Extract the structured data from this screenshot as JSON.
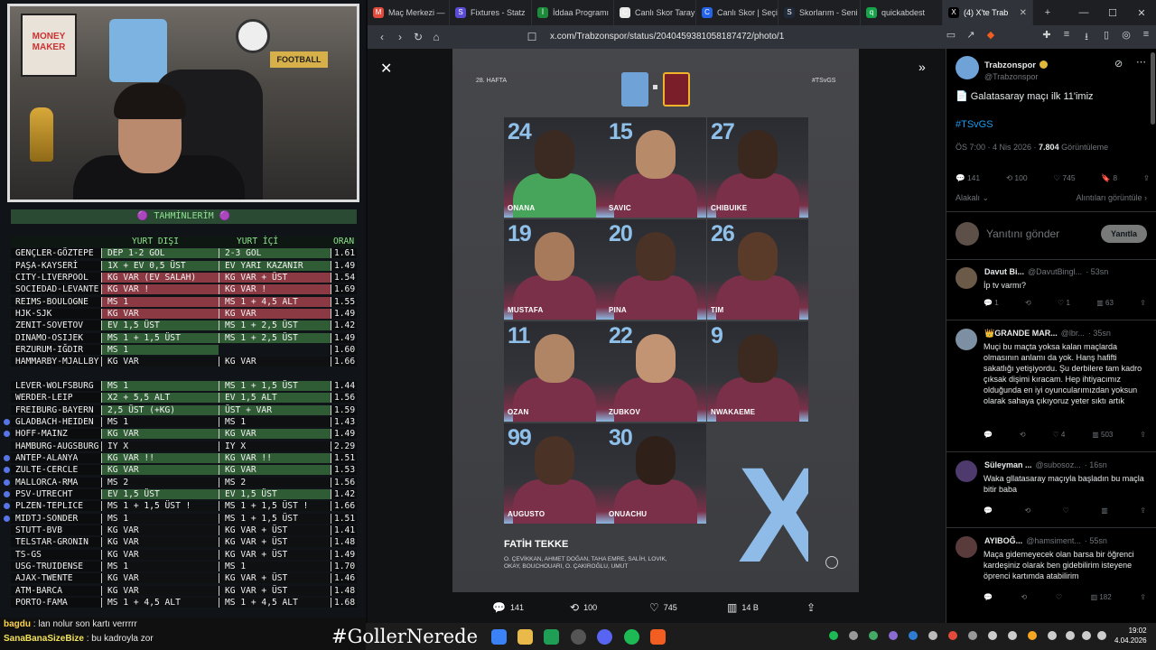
{
  "stream": {
    "predictions_title": "🟣 TAHMİNLERİM 🟣",
    "columns": {
      "away": "YURT DIŞI",
      "home": "YURT İÇİ",
      "odds": "ORAN"
    },
    "rows": [
      {
        "match": "GENÇLER-GÖZTEPE",
        "away": "DEP 1-2 GOL",
        "home": "2-3 GOL",
        "odds": "1.61",
        "ca": "c-green",
        "ch": "c-green",
        "dot": false
      },
      {
        "match": "PAŞA-KAYSERİ",
        "away": "1X + EV 0,5 ÜST",
        "home": "EV YARI KAZANIR",
        "odds": "1.49",
        "ca": "c-green",
        "ch": "c-green",
        "dot": false
      },
      {
        "match": "CITY-LIVERPOOL",
        "away": "KG VAR (EV SALAH)",
        "home": "KG VAR + ÜST",
        "odds": "1.54",
        "ca": "c-red",
        "ch": "c-red",
        "dot": false
      },
      {
        "match": "SOCIEDAD-LEVANTE",
        "away": "KG VAR !",
        "home": "KG VAR !",
        "odds": "1.69",
        "ca": "c-red",
        "ch": "c-red",
        "dot": false
      },
      {
        "match": "REIMS-BOULOGNE",
        "away": "MS 1",
        "home": "MS 1 + 4,5 ALT",
        "odds": "1.55",
        "ca": "c-red",
        "ch": "c-red",
        "dot": false
      },
      {
        "match": "HJK-SJK",
        "away": "KG VAR",
        "home": "KG VAR",
        "odds": "1.49",
        "ca": "c-red",
        "ch": "c-red",
        "dot": false
      },
      {
        "match": "ZENIT-SOVETOV",
        "away": "EV 1,5 ÜST",
        "home": "MS 1 + 2,5 ÜST",
        "odds": "1.42",
        "ca": "c-green",
        "ch": "c-green",
        "dot": false
      },
      {
        "match": "DINAMO-OSIJEK",
        "away": "MS 1 + 1,5 ÜST",
        "home": "MS 1 + 2,5 ÜST",
        "odds": "1.49",
        "ca": "c-green",
        "ch": "c-green",
        "dot": false
      },
      {
        "match": "ERZURUM-IĞDIR",
        "away": "MS 1",
        "home": "",
        "odds": "1.60",
        "ca": "c-green",
        "ch": "c-green",
        "dot": false
      },
      {
        "match": "HAMMARBY-MJALLBY",
        "away": "KG VAR",
        "home": "KG VAR",
        "odds": "1.66",
        "ca": "c-dark",
        "ch": "c-dark",
        "dot": false
      },
      {
        "match": "",
        "away": "",
        "home": "",
        "odds": "",
        "ca": "c-dark",
        "ch": "c-dark",
        "dot": false
      },
      {
        "match": "LEVER-WOLFSBURG",
        "away": "MS 1",
        "home": "MS 1 + 1,5 ÜST",
        "odds": "1.44",
        "ca": "c-green",
        "ch": "c-green",
        "dot": false
      },
      {
        "match": "WERDER-LEIP",
        "away": "X2 + 5,5 ALT",
        "home": "EV 1,5 ALT",
        "odds": "1.56",
        "ca": "c-green",
        "ch": "c-green",
        "dot": false
      },
      {
        "match": "FREIBURG-BAYERN",
        "away": "2,5 ÜST (+KG)",
        "home": "ÜST + VAR",
        "odds": "1.59",
        "ca": "c-green",
        "ch": "c-green",
        "dot": false
      },
      {
        "match": "GLADBACH-HEIDEN",
        "away": "MS 1",
        "home": "MS 1",
        "odds": "1.43",
        "ca": "c-dark",
        "ch": "c-dark",
        "dot": true
      },
      {
        "match": "HOFF-MAINZ",
        "away": "KG VAR",
        "home": "KG VAR",
        "odds": "1.49",
        "ca": "c-green",
        "ch": "c-green",
        "dot": true
      },
      {
        "match": "HAMBURG-AUGSBURG",
        "away": "IY X",
        "home": "IY X",
        "odds": "2.29",
        "ca": "c-dark",
        "ch": "c-dark",
        "dot": false
      },
      {
        "match": "ANTEP-ALANYA",
        "away": "KG VAR !!",
        "home": "KG VAR !!",
        "odds": "1.51",
        "ca": "c-green",
        "ch": "c-green",
        "dot": true
      },
      {
        "match": "ZULTE-CERCLE",
        "away": "KG VAR",
        "home": "KG VAR",
        "odds": "1.53",
        "ca": "c-green",
        "ch": "c-green",
        "dot": true
      },
      {
        "match": "MALLORCA-RMA",
        "away": "MS 2",
        "home": "MS 2",
        "odds": "1.56",
        "ca": "c-dark",
        "ch": "c-dark",
        "dot": true
      },
      {
        "match": "PSV-UTRECHT",
        "away": "EV 1,5 ÜST",
        "home": "EV 1,5 ÜST",
        "odds": "1.42",
        "ca": "c-green",
        "ch": "c-green",
        "dot": true
      },
      {
        "match": "PLZEN-TEPLICE",
        "away": "MS 1 + 1,5 ÜST !",
        "home": "MS 1 + 1,5 ÜST !",
        "odds": "1.66",
        "ca": "c-dark",
        "ch": "c-dark",
        "dot": true
      },
      {
        "match": "MIDTJ-SONDER",
        "away": "MS 1",
        "home": "MS 1 + 1,5 ÜST",
        "odds": "1.51",
        "ca": "c-dark",
        "ch": "c-dark",
        "dot": true
      },
      {
        "match": "STUTT-BVB",
        "away": "KG VAR",
        "home": "KG VAR + ÜST",
        "odds": "1.41",
        "ca": "c-dark",
        "ch": "c-dark",
        "dot": false
      },
      {
        "match": "TELSTAR-GRONIN",
        "away": "KG VAR",
        "home": "KG VAR + ÜST",
        "odds": "1.48",
        "ca": "c-dark",
        "ch": "c-dark",
        "dot": false
      },
      {
        "match": "TS-GS",
        "away": "KG VAR",
        "home": "KG VAR + ÜST",
        "odds": "1.49",
        "ca": "c-dark",
        "ch": "c-dark",
        "dot": false
      },
      {
        "match": "USG-TRUIDENSE",
        "away": "MS 1",
        "home": "MS 1",
        "odds": "1.70",
        "ca": "c-dark",
        "ch": "c-dark",
        "dot": false
      },
      {
        "match": "AJAX-TWENTE",
        "away": "KG VAR",
        "home": "KG VAR + ÜST",
        "odds": "1.46",
        "ca": "c-dark",
        "ch": "c-dark",
        "dot": false
      },
      {
        "match": "ATM-BARCA",
        "away": "KG VAR",
        "home": "KG VAR + ÜST",
        "odds": "1.48",
        "ca": "c-dark",
        "ch": "c-dark",
        "dot": false
      },
      {
        "match": "PORTO-FAMA",
        "away": "MS 1 + 4,5 ALT",
        "home": "MS 1 + 4,5 ALT",
        "odds": "1.68",
        "ca": "c-dark",
        "ch": "c-dark",
        "dot": false
      }
    ],
    "webcam": {
      "poster_text": "MONEY MAKER",
      "sign_text": "FOOTBALL"
    },
    "chat": [
      {
        "user": "bagdu",
        "color": "#ffd54a",
        "msg": "lan nolur son kartı verrrrr"
      },
      {
        "user": "SanaBanaSizeBize",
        "color": "#f3e35b",
        "msg": "bu kadroyla zor"
      }
    ],
    "hashtag": "#GollerNerede"
  },
  "browser": {
    "tabs": [
      {
        "label": "Maç Merkezi —",
        "color": "#e24a3b",
        "icon": "M",
        "active": false
      },
      {
        "label": "Fixtures - Statz",
        "color": "#5b4cd6",
        "icon": "S",
        "active": false
      },
      {
        "label": "İddaa Programı",
        "color": "#1c8c3a",
        "icon": "İ",
        "active": false
      },
      {
        "label": "Canlı Skor Tarayı",
        "color": "#e8e8e8",
        "icon": "C",
        "active": false
      },
      {
        "label": "Canlı Skor | Seçi",
        "color": "#2563eb",
        "icon": "C",
        "active": false
      },
      {
        "label": "Skorlarım - Seni",
        "color": "#1f2937",
        "icon": "S",
        "active": false
      },
      {
        "label": "quickabdest",
        "color": "#16a34a",
        "icon": "q",
        "active": false
      },
      {
        "label": "(4) X'te Trab",
        "color": "#000000",
        "icon": "X",
        "active": true
      }
    ],
    "url": "x.com/Trabzonspor/status/2040459381058187472/photo/1",
    "window_controls": [
      "—",
      "☐",
      "✕"
    ]
  },
  "poster": {
    "week": "28. HAFTA",
    "tag": "#TSvGS",
    "players": [
      {
        "num": "24",
        "name": "ONANA",
        "skin": "#3b2a21",
        "kit": "#46a55a"
      },
      {
        "num": "15",
        "name": "SAVIC",
        "skin": "#b78a6a",
        "kit": "#7a3048"
      },
      {
        "num": "27",
        "name": "CHIBUIKE",
        "skin": "#3a271e",
        "kit": "#7a3048"
      },
      {
        "num": "19",
        "name": "MUSTAFA",
        "skin": "#a67a5b",
        "kit": "#7a3048"
      },
      {
        "num": "20",
        "name": "PINA",
        "skin": "#4a3227",
        "kit": "#7a3048"
      },
      {
        "num": "26",
        "name": "TIM",
        "skin": "#5a3b2a",
        "kit": "#7a3048"
      },
      {
        "num": "11",
        "name": "OZAN",
        "skin": "#b08566",
        "kit": "#7a3048"
      },
      {
        "num": "22",
        "name": "ZUBKOV",
        "skin": "#c29473",
        "kit": "#7a3048"
      },
      {
        "num": "9",
        "name": "NWAKAEME",
        "skin": "#3c291f",
        "kit": "#7a3048"
      },
      {
        "num": "99",
        "name": "AUGUSTO",
        "skin": "#4a3226",
        "kit": "#7a3048"
      },
      {
        "num": "30",
        "name": "ONUACHU",
        "skin": "#2f2019",
        "kit": "#7a3048"
      }
    ],
    "xi": "XI",
    "coach": "FATİH TEKKE",
    "staff": "O. ÇEVİKKAN, AHMET DOĞAN, TAHA EMRE, SALİH, LOVIK, OKAY, BOUCHOUARI, O. ÇAKIROĞLU, UMUT"
  },
  "viewer_actions": {
    "replies": "141",
    "reposts": "100",
    "likes": "745",
    "views": "14 B"
  },
  "tweet": {
    "name": "Trabzonspor",
    "handle": "@Trabzonspor",
    "text": "📄 Galatasaray maçı ilk 11'imiz",
    "hashtag": "#TSvGS",
    "time": "ÖS 7:00 · 4 Nis 2026 · ",
    "views_count": "7.804",
    "views_label": " Görüntüleme",
    "stats": {
      "replies": "141",
      "reposts": "100",
      "likes": "745",
      "bookmarks": "8"
    },
    "sort": "Alakalı",
    "quotes_link": "Alıntıları görüntüle",
    "reply_placeholder": "Yanıtını gönder",
    "reply_button": "Yanıtla"
  },
  "replies": [
    {
      "name": "Davut Bi...",
      "handle": "@DavutBingl...",
      "time": "· 53sn",
      "text": "İp tv varmı?",
      "c": "1",
      "r": "",
      "l": "1",
      "v": "63",
      "av": "#6b5a48"
    },
    {
      "name": "👑GRANDE MAR...",
      "handle": "@lbr...",
      "time": "· 35sn",
      "text": "Muçi bu maçta yoksa kalan maçlarda olmasının anlamı da yok. Hanş hafifti sakatlığı yetişiyordu. Şu derbilere tam kadro çıksak dişimi kıracam. Hep ihtiyacımız olduğunda en iyi oyuncularımızdan yoksun olarak sahaya çıkıyoruz yeter sıktı artık",
      "c": "",
      "r": "",
      "l": "4",
      "v": "503",
      "av": "#7c8fa3"
    },
    {
      "name": "Süleyman ...",
      "handle": "@subosoz...",
      "time": "· 16sn",
      "text": "Waka gllatasaray maçıyla başladın bu maçla bitir baba",
      "c": "",
      "r": "",
      "l": "",
      "v": "",
      "av": "#4f3a6d"
    },
    {
      "name": "AYIBOĞ...",
      "handle": "@hamsiment...",
      "time": "· 55sn",
      "text": "Maça gidemeyecek olan barsa bir öğrenci kardeşiniz olarak ben gidebilirim isteyene öprenci kartımda atabilirim",
      "c": "",
      "r": "",
      "l": "",
      "v": "182",
      "av": "#5a3b3b"
    }
  ],
  "clock": {
    "time": "19:02",
    "date": "4.04.2026"
  }
}
